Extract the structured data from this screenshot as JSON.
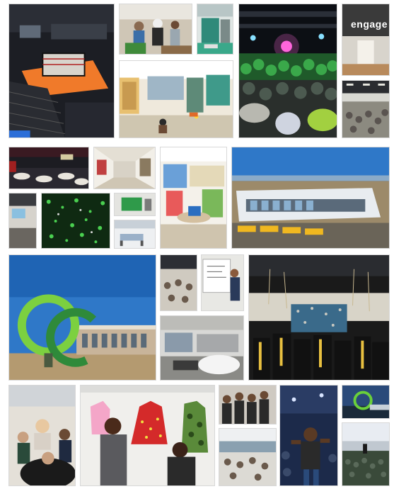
{
  "collage": {
    "signs": {
      "engage": "engage"
    }
  },
  "colors": {
    "sky": "#2f78c8",
    "arena_orange": "#f07a2a",
    "crowd_green": "#3aa84a",
    "logo_green": "#5cc23a",
    "graduation_black": "#1a1a1a",
    "engage_wall": "#3a3a3a"
  }
}
